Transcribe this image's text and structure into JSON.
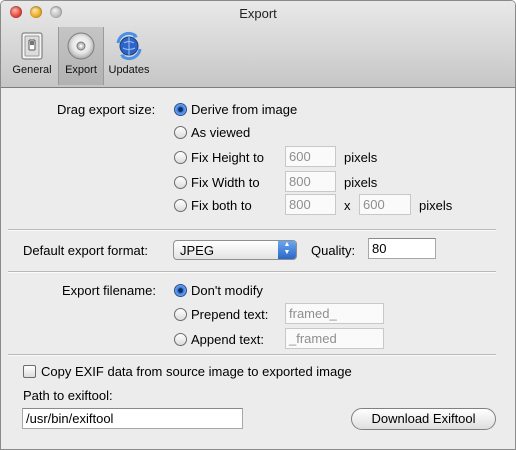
{
  "window": {
    "title": "Export"
  },
  "toolbar": {
    "items": [
      {
        "label": "General",
        "icon": "general-switch-icon"
      },
      {
        "label": "Export",
        "icon": "export-disc-icon"
      },
      {
        "label": "Updates",
        "icon": "updates-globe-icon"
      }
    ],
    "selected": "Export"
  },
  "drag_export": {
    "label": "Drag export size:",
    "options": [
      {
        "label": "Derive from image",
        "selected": true
      },
      {
        "label": "As viewed",
        "selected": false
      },
      {
        "label": "Fix Height to",
        "selected": false,
        "value": "600",
        "unit": "pixels"
      },
      {
        "label": "Fix Width to",
        "selected": false,
        "value": "800",
        "unit": "pixels"
      },
      {
        "label": "Fix both to",
        "selected": false,
        "value": "800",
        "separator": "x",
        "value2": "600",
        "unit": "pixels"
      }
    ]
  },
  "format": {
    "label": "Default export format:",
    "selected": "JPEG",
    "quality_label": "Quality:",
    "quality_value": "80"
  },
  "filename": {
    "label": "Export filename:",
    "options": [
      {
        "label": "Don't modify",
        "selected": true
      },
      {
        "label": "Prepend text:",
        "selected": false,
        "placeholder": "framed_"
      },
      {
        "label": "Append text:",
        "selected": false,
        "placeholder": "_framed"
      }
    ]
  },
  "exif": {
    "checkbox_label": "Copy EXIF data from source image to exported image",
    "checked": false,
    "path_label": "Path to exiftool:",
    "path_value": "/usr/bin/exiftool",
    "download_button": "Download Exiftool"
  }
}
